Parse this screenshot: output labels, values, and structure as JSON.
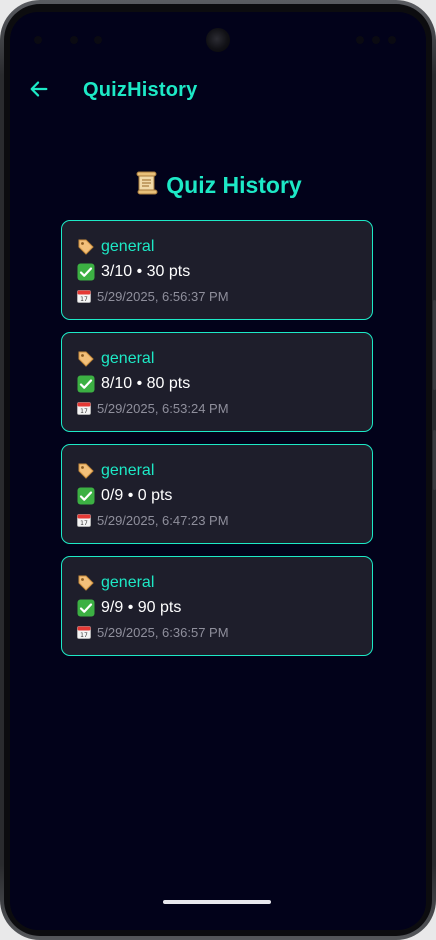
{
  "app_bar": {
    "title": "QuizHistory",
    "back_icon": "arrow-left-icon"
  },
  "page": {
    "heading": "Quiz History",
    "heading_icon": "scroll-icon"
  },
  "history": [
    {
      "category": "general",
      "score": "3/10 • 30 pts",
      "date": "5/29/2025, 6:56:37 PM"
    },
    {
      "category": "general",
      "score": "8/10 • 80 pts",
      "date": "5/29/2025, 6:53:24 PM"
    },
    {
      "category": "general",
      "score": "0/9 • 0 pts",
      "date": "5/29/2025, 6:47:23 PM"
    },
    {
      "category": "general",
      "score": "9/9 • 90 pts",
      "date": "5/29/2025, 6:36:57 PM"
    }
  ],
  "colors": {
    "background": "#02021a",
    "accent": "#1de9c6",
    "card": "#1e1e2b",
    "muted_text": "#8f8f9c"
  }
}
